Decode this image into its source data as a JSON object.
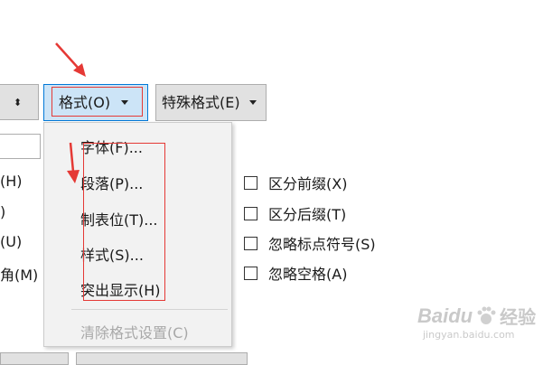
{
  "toolbar": {
    "format_label": "格式(O)",
    "special_label": "特殊格式(E)",
    "stepper_symbol": "⬍"
  },
  "format_menu": {
    "items": [
      {
        "label": "字体(F)..."
      },
      {
        "label": "段落(P)..."
      },
      {
        "label": "制表位(T)..."
      },
      {
        "label": "样式(S)..."
      },
      {
        "label": "突出显示(H)"
      }
    ],
    "disabled_item": "清除格式设置(C)"
  },
  "left_partial_labels": [
    "(H)",
    ")",
    "(U)",
    "角(M)"
  ],
  "options": [
    {
      "label": "区分前缀(X)",
      "checked": false
    },
    {
      "label": "区分后缀(T)",
      "checked": false
    },
    {
      "label": "忽略标点符号(S)",
      "checked": false
    },
    {
      "label": "忽略空格(A)",
      "checked": false
    }
  ],
  "watermark": {
    "brand": "Baidu",
    "sub": "经验",
    "url": "jingyan.baidu.com"
  },
  "colors": {
    "accent_blue": "#0078d7",
    "button_highlight": "#cce4f7",
    "annotation_red": "#e53935"
  }
}
